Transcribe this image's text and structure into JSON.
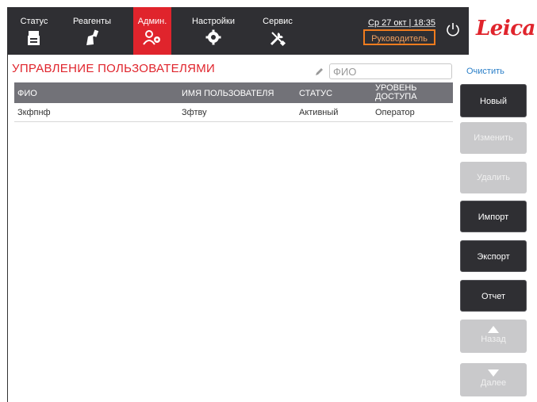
{
  "nav": {
    "tabs": [
      {
        "label": "Статус",
        "icon": "status-icon"
      },
      {
        "label": "Реагенты",
        "icon": "reagent-bottle-icon"
      },
      {
        "label": "Админ.",
        "icon": "admin-users-icon"
      },
      {
        "label": "Настройки",
        "icon": "settings-gear-icon"
      },
      {
        "label": "Сервис",
        "icon": "service-tools-icon"
      }
    ],
    "active_tab": "Админ."
  },
  "header": {
    "datetime": "Ср 27 окт | 18:35",
    "role": "Руководитель",
    "logo": "Leica"
  },
  "page": {
    "title": "УПРАВЛЕНИЕ ПОЛЬЗОВАТЕЛЯМИ",
    "search_placeholder": "ФИО",
    "clear_label": "Очистить"
  },
  "table": {
    "columns": [
      "ФИО",
      "ИМЯ ПОЛЬЗОВАТЕЛЯ",
      "СТАТУС",
      "УРОВЕНЬ",
      "ДОСТУПА"
    ],
    "rows": [
      {
        "name": "Зкфпнф",
        "username": "Зфтву",
        "status": "Активный",
        "access": "Оператор"
      }
    ]
  },
  "buttons": {
    "new": "Новый",
    "edit": "Изменить",
    "delete": "Удалить",
    "import": "Импорт",
    "export": "Экспорт",
    "report": "Отчет",
    "back": "Назад",
    "next": "Далее"
  },
  "colors": {
    "brand_red": "#e0242c",
    "nav_dark": "#2f2f33",
    "role_outline": "#f07c1e",
    "link_blue": "#2a7fc8"
  }
}
